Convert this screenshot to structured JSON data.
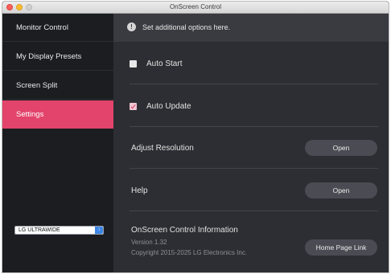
{
  "window": {
    "title": "OnScreen Control"
  },
  "sidebar": {
    "items": [
      {
        "label": "Monitor Control"
      },
      {
        "label": "My Display Presets"
      },
      {
        "label": "Screen Split"
      },
      {
        "label": "Settings"
      }
    ],
    "monitor_select": {
      "value": "LG ULTRAWIDE"
    }
  },
  "content": {
    "info_text": "Set additional options here.",
    "options": {
      "auto_start": {
        "label": "Auto Start",
        "checked": false
      },
      "auto_update": {
        "label": "Auto Update",
        "checked": true
      }
    },
    "adjust_resolution": {
      "label": "Adjust Resolution",
      "button": "Open"
    },
    "help": {
      "label": "Help",
      "button": "Open"
    },
    "about": {
      "title": "OnScreen Control Information",
      "version": "Version 1.32",
      "copyright": "Copyright 2015-2025 LG Electronics Inc.",
      "button": "Home Page Link"
    }
  },
  "colors": {
    "accent": "#e2446b",
    "sidebar_bg": "#1c1d21",
    "content_bg": "#2d2e33"
  }
}
